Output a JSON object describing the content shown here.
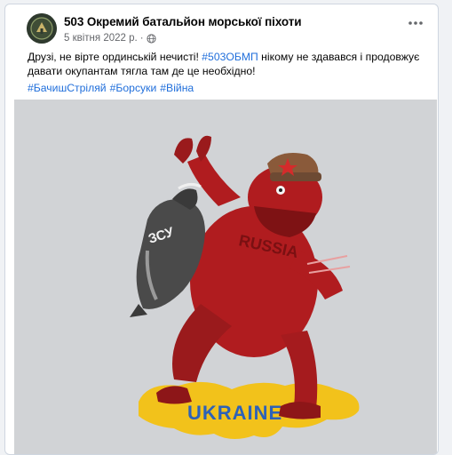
{
  "post": {
    "page_name": "503 Окремий батальйон морської піхоти",
    "date": "5 квітня 2022 р.",
    "separator": "·",
    "text_part1": "Друзі, не вірте ординській нечисті! ",
    "hashtag_inline": "#503ОБМП",
    "text_part2": " нікому не здавався і продовжує давати окупантам тягла там де це необхідно!",
    "hashtags": [
      "#БачишСтріляй",
      "#Борсуки",
      "#Війна"
    ]
  },
  "image": {
    "badger_label": "ЗСУ",
    "bear_label": "RUSSIA",
    "map_label": "UKRAINE",
    "colors": {
      "background": "#d1d3d6",
      "bear": "#b01c1f",
      "badger": "#4a4a4a",
      "map_yellow": "#f2c21b",
      "map_blue": "#2d62b8"
    }
  },
  "icons": {
    "privacy": "globe-icon",
    "menu": "more-options-icon"
  }
}
